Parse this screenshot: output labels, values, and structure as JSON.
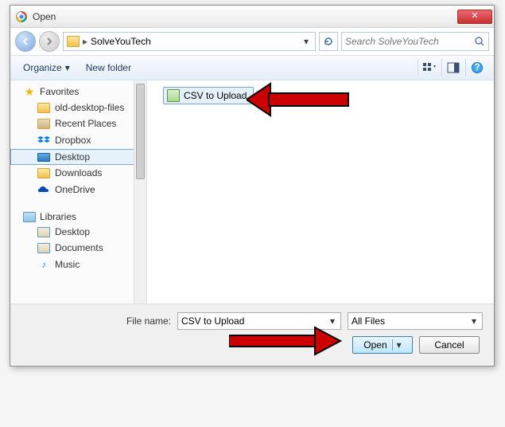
{
  "window": {
    "title": "Open"
  },
  "nav": {
    "location": "SolveYouTech",
    "search_placeholder": "Search SolveYouTech"
  },
  "toolbar": {
    "organize": "Organize",
    "newfolder": "New folder"
  },
  "sidebar": {
    "favorites_label": "Favorites",
    "favorites": [
      {
        "label": "old-desktop-files"
      },
      {
        "label": "Recent Places"
      },
      {
        "label": "Dropbox"
      },
      {
        "label": "Desktop"
      },
      {
        "label": "Downloads"
      },
      {
        "label": "OneDrive"
      }
    ],
    "libraries_label": "Libraries",
    "libraries": [
      {
        "label": "Desktop"
      },
      {
        "label": "Documents"
      },
      {
        "label": "Music"
      }
    ]
  },
  "content": {
    "selected_file": "CSV to Upload"
  },
  "footer": {
    "filename_label": "File name:",
    "filename_value": "CSV to Upload",
    "filter": "All Files",
    "open": "Open",
    "cancel": "Cancel"
  }
}
